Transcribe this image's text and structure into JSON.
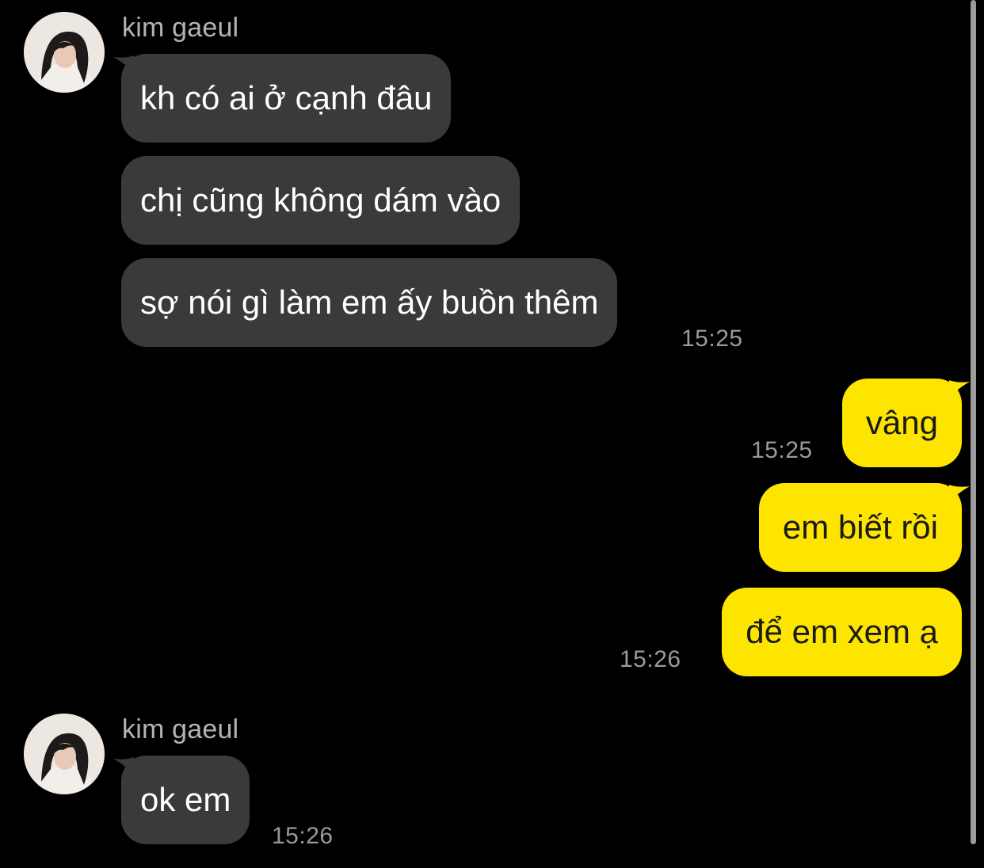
{
  "sender_name": "kim gaeul",
  "messages": {
    "m1": "kh có ai ở cạnh đâu",
    "m2": "chị cũng không dám vào",
    "m3": "sợ nói gì làm em ấy buồn thêm",
    "m4": "vâng",
    "m5": "em biết rồi",
    "m6": "để em xem ạ",
    "m7": "ok em"
  },
  "times": {
    "t1": "15:25",
    "t2": "15:25",
    "t3": "15:26",
    "t4": "15:26"
  },
  "colors": {
    "incoming_bubble": "#3a3a3c",
    "outgoing_bubble": "#fde500",
    "background": "#000000"
  }
}
